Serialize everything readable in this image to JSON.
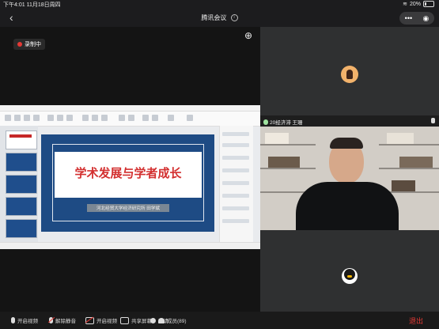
{
  "status_bar": {
    "time": "下午4:01",
    "date": "11月18日周四",
    "battery": "20%",
    "battery_level": 0.2
  },
  "header": {
    "back_glyph": "‹",
    "title": "腾讯会议",
    "info_glyph": "i",
    "more_glyph": "•••",
    "target_glyph": "◉"
  },
  "share": {
    "zoom_glyph": "⊕",
    "recording_label": "录制中",
    "slide_title": "学术发展与学者成长",
    "slide_subtitle": "河北经贸大学经济研究所 田学斌"
  },
  "participants": {
    "video_tile_name": "20经济滞 王珊"
  },
  "toolbar": {
    "audio_label": "开启视频",
    "mute_label": "解除静音",
    "video_label": "开启视频",
    "share_label": "共享屏幕",
    "invite_label": "邀请",
    "members_label": "成员(89)",
    "leave_label": "退出"
  },
  "colors": {
    "recording_dot": "#e53935",
    "slide_bg": "#1e4b84",
    "slide_title": "#d32f2f",
    "leave": "#e53935"
  }
}
